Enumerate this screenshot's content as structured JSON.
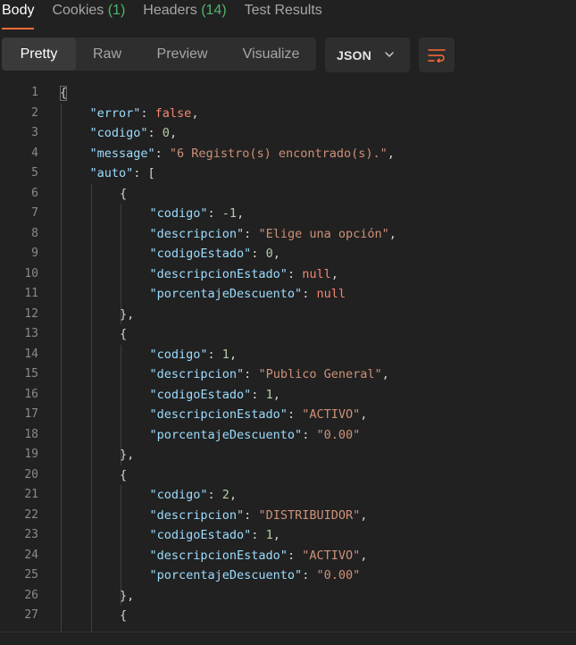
{
  "response_tabs": [
    {
      "label": "Body",
      "count": "",
      "active": true
    },
    {
      "label": "Cookies ",
      "count": "(1)",
      "active": false
    },
    {
      "label": "Headers ",
      "count": "(14)",
      "active": false
    },
    {
      "label": "Test Results",
      "count": "",
      "active": false
    }
  ],
  "view_modes": [
    {
      "label": "Pretty",
      "active": true
    },
    {
      "label": "Raw",
      "active": false
    },
    {
      "label": "Preview",
      "active": false
    },
    {
      "label": "Visualize",
      "active": false
    }
  ],
  "format_select": {
    "value": "JSON",
    "icon": "chevron-down-icon"
  },
  "wrap_button": {
    "icon": "text-wrap-icon"
  },
  "colors": {
    "accent": "#ff6c37",
    "count": "#4fb56b",
    "json_key": "#9cdcfe",
    "json_string": "#ce9178",
    "json_number": "#b5cea8",
    "json_keyword": "#f48771"
  },
  "code_lines": [
    {
      "n": "1",
      "indent": 0,
      "tokens": [
        [
          "p",
          "{"
        ]
      ]
    },
    {
      "n": "2",
      "indent": 1,
      "tokens": [
        [
          "k",
          "\"error\""
        ],
        [
          "p",
          ": "
        ],
        [
          "kw",
          "false"
        ],
        [
          "p",
          ","
        ]
      ]
    },
    {
      "n": "3",
      "indent": 1,
      "tokens": [
        [
          "k",
          "\"codigo\""
        ],
        [
          "p",
          ": "
        ],
        [
          "n",
          "0"
        ],
        [
          "p",
          ","
        ]
      ]
    },
    {
      "n": "4",
      "indent": 1,
      "tokens": [
        [
          "k",
          "\"message\""
        ],
        [
          "p",
          ": "
        ],
        [
          "s",
          "\"6 Registro(s) encontrado(s).\""
        ],
        [
          "p",
          ","
        ]
      ]
    },
    {
      "n": "5",
      "indent": 1,
      "tokens": [
        [
          "k",
          "\"auto\""
        ],
        [
          "p",
          ": ["
        ]
      ]
    },
    {
      "n": "6",
      "indent": 2,
      "tokens": [
        [
          "p",
          "{"
        ]
      ]
    },
    {
      "n": "7",
      "indent": 3,
      "tokens": [
        [
          "k",
          "\"codigo\""
        ],
        [
          "p",
          ": "
        ],
        [
          "n",
          "-1"
        ],
        [
          "p",
          ","
        ]
      ]
    },
    {
      "n": "8",
      "indent": 3,
      "tokens": [
        [
          "k",
          "\"descripcion\""
        ],
        [
          "p",
          ": "
        ],
        [
          "s",
          "\"Elige una opción\""
        ],
        [
          "p",
          ","
        ]
      ]
    },
    {
      "n": "9",
      "indent": 3,
      "tokens": [
        [
          "k",
          "\"codigoEstado\""
        ],
        [
          "p",
          ": "
        ],
        [
          "n",
          "0"
        ],
        [
          "p",
          ","
        ]
      ]
    },
    {
      "n": "10",
      "indent": 3,
      "tokens": [
        [
          "k",
          "\"descripcionEstado\""
        ],
        [
          "p",
          ": "
        ],
        [
          "kw",
          "null"
        ],
        [
          "p",
          ","
        ]
      ]
    },
    {
      "n": "11",
      "indent": 3,
      "tokens": [
        [
          "k",
          "\"porcentajeDescuento\""
        ],
        [
          "p",
          ": "
        ],
        [
          "kw",
          "null"
        ]
      ]
    },
    {
      "n": "12",
      "indent": 2,
      "tokens": [
        [
          "p",
          "},"
        ]
      ]
    },
    {
      "n": "13",
      "indent": 2,
      "tokens": [
        [
          "p",
          "{"
        ]
      ]
    },
    {
      "n": "14",
      "indent": 3,
      "tokens": [
        [
          "k",
          "\"codigo\""
        ],
        [
          "p",
          ": "
        ],
        [
          "n",
          "1"
        ],
        [
          "p",
          ","
        ]
      ]
    },
    {
      "n": "15",
      "indent": 3,
      "tokens": [
        [
          "k",
          "\"descripcion\""
        ],
        [
          "p",
          ": "
        ],
        [
          "s",
          "\"Publico General\""
        ],
        [
          "p",
          ","
        ]
      ]
    },
    {
      "n": "16",
      "indent": 3,
      "tokens": [
        [
          "k",
          "\"codigoEstado\""
        ],
        [
          "p",
          ": "
        ],
        [
          "n",
          "1"
        ],
        [
          "p",
          ","
        ]
      ]
    },
    {
      "n": "17",
      "indent": 3,
      "tokens": [
        [
          "k",
          "\"descripcionEstado\""
        ],
        [
          "p",
          ": "
        ],
        [
          "s",
          "\"ACTIVO\""
        ],
        [
          "p",
          ","
        ]
      ]
    },
    {
      "n": "18",
      "indent": 3,
      "tokens": [
        [
          "k",
          "\"porcentajeDescuento\""
        ],
        [
          "p",
          ": "
        ],
        [
          "s",
          "\"0.00\""
        ]
      ]
    },
    {
      "n": "19",
      "indent": 2,
      "tokens": [
        [
          "p",
          "},"
        ]
      ]
    },
    {
      "n": "20",
      "indent": 2,
      "tokens": [
        [
          "p",
          "{"
        ]
      ]
    },
    {
      "n": "21",
      "indent": 3,
      "tokens": [
        [
          "k",
          "\"codigo\""
        ],
        [
          "p",
          ": "
        ],
        [
          "n",
          "2"
        ],
        [
          "p",
          ","
        ]
      ]
    },
    {
      "n": "22",
      "indent": 3,
      "tokens": [
        [
          "k",
          "\"descripcion\""
        ],
        [
          "p",
          ": "
        ],
        [
          "s",
          "\"DISTRIBUIDOR\""
        ],
        [
          "p",
          ","
        ]
      ]
    },
    {
      "n": "23",
      "indent": 3,
      "tokens": [
        [
          "k",
          "\"codigoEstado\""
        ],
        [
          "p",
          ": "
        ],
        [
          "n",
          "1"
        ],
        [
          "p",
          ","
        ]
      ]
    },
    {
      "n": "24",
      "indent": 3,
      "tokens": [
        [
          "k",
          "\"descripcionEstado\""
        ],
        [
          "p",
          ": "
        ],
        [
          "s",
          "\"ACTIVO\""
        ],
        [
          "p",
          ","
        ]
      ]
    },
    {
      "n": "25",
      "indent": 3,
      "tokens": [
        [
          "k",
          "\"porcentajeDescuento\""
        ],
        [
          "p",
          ": "
        ],
        [
          "s",
          "\"0.00\""
        ]
      ]
    },
    {
      "n": "26",
      "indent": 2,
      "tokens": [
        [
          "p",
          "},"
        ]
      ]
    },
    {
      "n": "27",
      "indent": 2,
      "tokens": [
        [
          "p",
          "{"
        ]
      ]
    }
  ]
}
